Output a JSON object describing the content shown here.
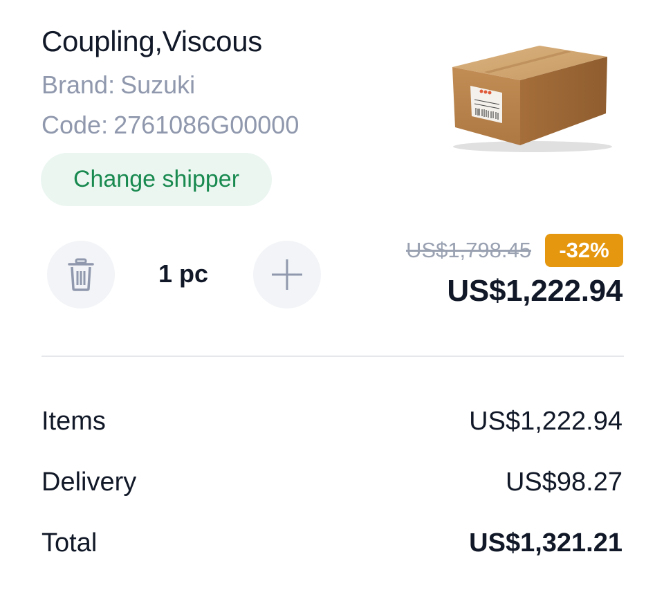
{
  "product": {
    "title": "Coupling,Viscous",
    "brand_label": "Brand:",
    "brand": "Suzuki",
    "code_label": "Code:",
    "code": "2761086G00000",
    "image_icon": "cardboard-box-image"
  },
  "shipper_button": {
    "label": "Change shipper"
  },
  "quantity": {
    "value": "1 pc",
    "delete_icon": "trash-icon",
    "add_icon": "plus-icon"
  },
  "pricing": {
    "old_price": "US$1,798.45",
    "discount": "-32%",
    "price": "US$1,222.94"
  },
  "summary": {
    "items_label": "Items",
    "items_value": "US$1,222.94",
    "delivery_label": "Delivery",
    "delivery_value": "US$98.27",
    "total_label": "Total",
    "total_value": "US$1,321.21"
  },
  "colors": {
    "accent_green": "#18894f",
    "badge_orange": "#e5980f",
    "muted_text": "#8f98ad"
  }
}
